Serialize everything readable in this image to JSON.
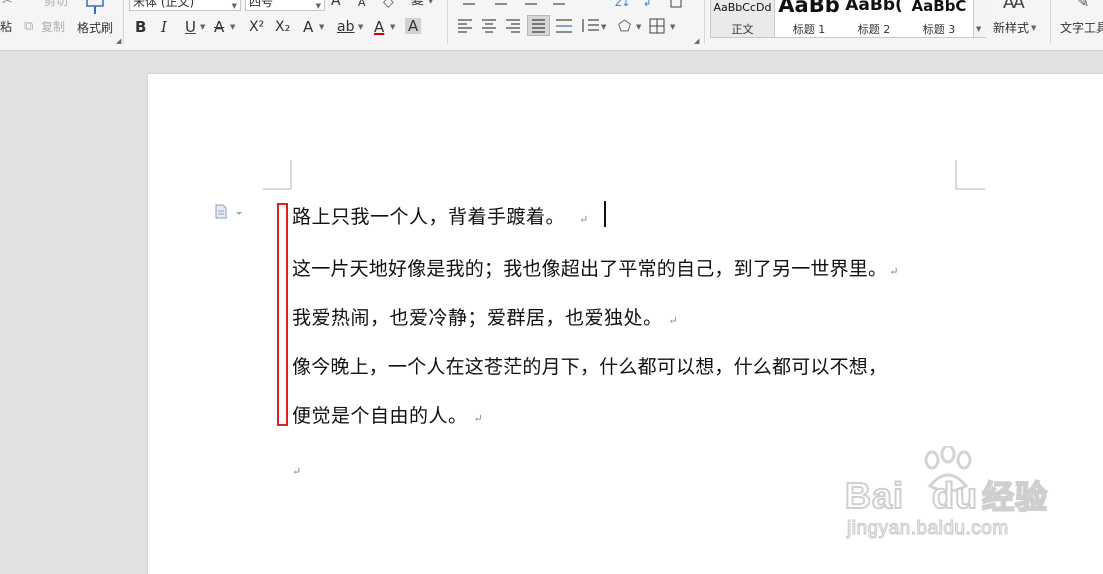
{
  "toolbar": {
    "cut_label": "剪切",
    "copy_label": "复制",
    "paste_label": "粘",
    "format_painter_label": "格式刷",
    "font_name": "宋体 (正文)",
    "font_size": "四号",
    "bold": "B",
    "italic": "I",
    "underline": "U",
    "strike": "A",
    "superscript": "X²",
    "subscript": "X₂",
    "text_effect": "A",
    "highlight": "ab",
    "font_color": "A",
    "char_shade": "A",
    "grow_font": "A",
    "shrink_font": "A",
    "clear_format": "◇",
    "phonetic": "變"
  },
  "styles": [
    {
      "preview": "AaBbCcDd",
      "name": "正文"
    },
    {
      "preview": "AaBb",
      "name": "标题 1"
    },
    {
      "preview": "AaBb(",
      "name": "标题 2"
    },
    {
      "preview": "AaBbC",
      "name": "标题 3"
    }
  ],
  "new_style_label": "新样式",
  "new_style_icon_text": "AA",
  "text_tools_label": "文字工具",
  "document": {
    "paragraphs": [
      "路上只我一个人，背着手踱着。",
      "这一片天地好像是我的；我也像超出了平常的自己，到了另一世界里。",
      "我爱热闹，也爱冷静；爱群居，也爱独处。",
      "像今晚上，一个人在这苍茫的月下，什么都可以想，什么都可以不想，",
      "便觉是个自由的人。"
    ],
    "paragraph_mark": "↵"
  },
  "watermark": {
    "brand": "Bai",
    "brand2": "du",
    "cn": "经验",
    "url": "jingyan.baidu.com"
  },
  "colors": {
    "highlight_box": "#e02020",
    "font_color_bar": "#d40000",
    "underline_color": "#1f4f9f"
  }
}
